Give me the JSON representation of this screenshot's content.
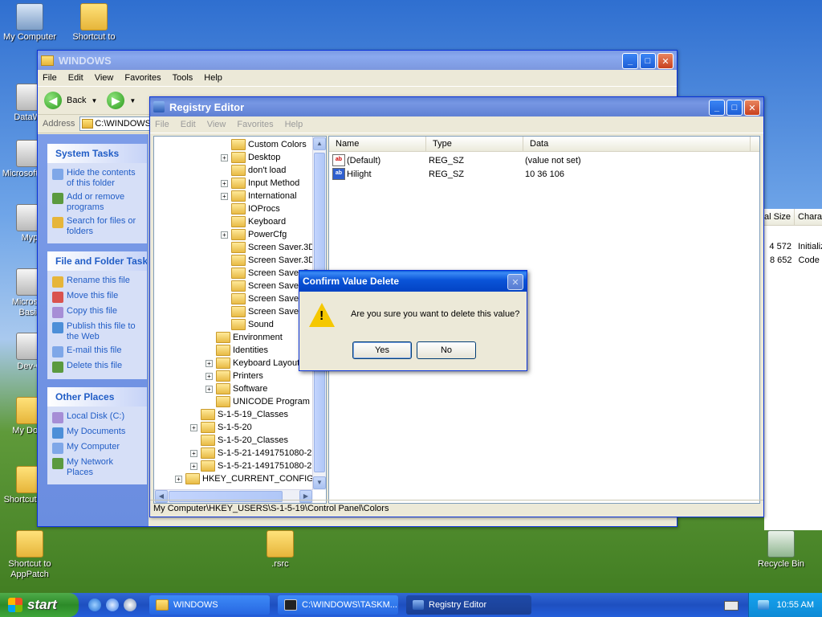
{
  "desktop_icons": [
    {
      "label": "My Computer",
      "kind": "pc"
    },
    {
      "label": "Shortcut to",
      "kind": "folder"
    },
    {
      "label": "DataWa",
      "kind": "app"
    },
    {
      "label": "Microsoft C++",
      "kind": "app"
    },
    {
      "label": "Myp",
      "kind": "app"
    },
    {
      "label": "Microsoft Basic",
      "kind": "app"
    },
    {
      "label": "Dev-C",
      "kind": "app"
    },
    {
      "label": "My Docu",
      "kind": "folder"
    },
    {
      "label": "Shortcut addi",
      "kind": "folder"
    },
    {
      "label": "Shortcut to AppPatch",
      "kind": "folder"
    },
    {
      "label": ".rsrc",
      "kind": "folder"
    },
    {
      "label": "Recycle Bin",
      "kind": "bin"
    }
  ],
  "explorer": {
    "title": "WINDOWS",
    "menu": [
      "File",
      "Edit",
      "View",
      "Favorites",
      "Tools",
      "Help"
    ],
    "back_label": "Back",
    "address_label": "Address",
    "address_value": "C:\\WINDOWS",
    "panels": [
      {
        "title": "System Tasks",
        "items": [
          "Hide the contents of this folder",
          "Add or remove programs",
          "Search for files or folders"
        ]
      },
      {
        "title": "File and Folder Tasks",
        "items": [
          "Rename this file",
          "Move this file",
          "Copy this file",
          "Publish this file to the Web",
          "E-mail this file",
          "Delete this file"
        ]
      },
      {
        "title": "Other Places",
        "items": [
          "Local Disk (C:)",
          "My Documents",
          "My Computer",
          "My Network Places"
        ]
      }
    ],
    "right_headers": [
      "al Size",
      "Chara"
    ],
    "right_rows": [
      [
        "4 572",
        "Initializ"
      ],
      [
        "8 652",
        "Code I"
      ]
    ]
  },
  "regedit": {
    "title": "Registry Editor",
    "menu": [
      "File",
      "Edit",
      "View",
      "Favorites",
      "Help"
    ],
    "tree": [
      {
        "label": "Custom Colors",
        "indent": 3,
        "plus": false
      },
      {
        "label": "Desktop",
        "indent": 3,
        "plus": true
      },
      {
        "label": "don't load",
        "indent": 3,
        "plus": false
      },
      {
        "label": "Input Method",
        "indent": 3,
        "plus": true
      },
      {
        "label": "International",
        "indent": 3,
        "plus": true
      },
      {
        "label": "IOProcs",
        "indent": 3,
        "plus": false
      },
      {
        "label": "Keyboard",
        "indent": 3,
        "plus": false
      },
      {
        "label": "PowerCfg",
        "indent": 3,
        "plus": true
      },
      {
        "label": "Screen Saver.3D",
        "indent": 3,
        "plus": false
      },
      {
        "label": "Screen Saver.3D",
        "indent": 3,
        "plus": false
      },
      {
        "label": "Screen Saver.B",
        "indent": 3,
        "plus": false
      },
      {
        "label": "Screen Saver",
        "indent": 3,
        "plus": false
      },
      {
        "label": "Screen Saver",
        "indent": 3,
        "plus": false
      },
      {
        "label": "Screen Saver",
        "indent": 3,
        "plus": false
      },
      {
        "label": "Sound",
        "indent": 3,
        "plus": false
      },
      {
        "label": "Environment",
        "indent": 2,
        "plus": false
      },
      {
        "label": "Identities",
        "indent": 2,
        "plus": false
      },
      {
        "label": "Keyboard Layout",
        "indent": 2,
        "plus": true
      },
      {
        "label": "Printers",
        "indent": 2,
        "plus": true
      },
      {
        "label": "Software",
        "indent": 2,
        "plus": true
      },
      {
        "label": "UNICODE Program G",
        "indent": 2,
        "plus": false
      },
      {
        "label": "S-1-5-19_Classes",
        "indent": 1,
        "plus": false
      },
      {
        "label": "S-1-5-20",
        "indent": 1,
        "plus": true
      },
      {
        "label": "S-1-5-20_Classes",
        "indent": 1,
        "plus": false
      },
      {
        "label": "S-1-5-21-1491751080-2",
        "indent": 1,
        "plus": true
      },
      {
        "label": "S-1-5-21-1491751080-2",
        "indent": 1,
        "plus": true
      },
      {
        "label": "HKEY_CURRENT_CONFIG",
        "indent": 0,
        "plus": true
      }
    ],
    "columns": [
      "Name",
      "Type",
      "Data"
    ],
    "values": [
      {
        "name": "(Default)",
        "type": "REG_SZ",
        "data": "(value not set)",
        "selected": false
      },
      {
        "name": "Hilight",
        "type": "REG_SZ",
        "data": "10 36 106",
        "selected": true
      }
    ],
    "status": "My Computer\\HKEY_USERS\\S-1-5-19\\Control Panel\\Colors"
  },
  "dialog": {
    "title": "Confirm Value Delete",
    "message": "Are you sure you want to delete this value?",
    "yes": "Yes",
    "no": "No"
  },
  "taskbar": {
    "start": "start",
    "tasks": [
      "WINDOWS",
      "C:\\WINDOWS\\TASKM...",
      "Registry Editor"
    ],
    "clock": "10:55 AM"
  }
}
